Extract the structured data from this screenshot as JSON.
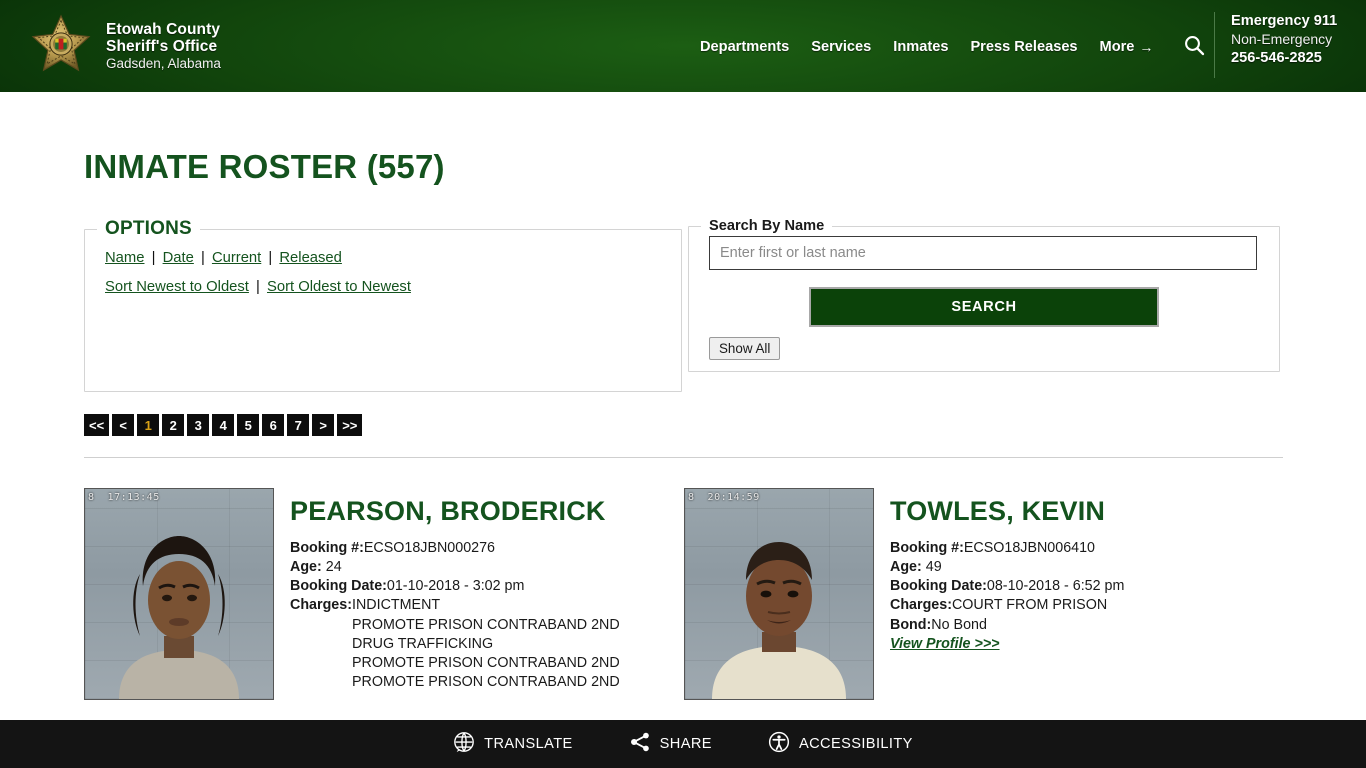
{
  "header": {
    "brand": {
      "line1": "Etowah County",
      "line2": "Sheriff's Office",
      "line3": "Gadsden, Alabama",
      "badge_icon": "sheriff-star-badge-icon"
    },
    "nav": [
      {
        "label": "Departments"
      },
      {
        "label": "Services"
      },
      {
        "label": "Inmates"
      },
      {
        "label": "Press Releases"
      },
      {
        "label": "More",
        "arrow": "→"
      }
    ],
    "search_icon": "search-icon",
    "contact": {
      "emergency": "Emergency 911",
      "non_emergency_label": "Non-Emergency",
      "non_emergency_number": "256-546-2825"
    },
    "colors": {
      "bg_dark": "#062a06",
      "bg_mid": "#134a0f",
      "text": "#ffffff"
    }
  },
  "page": {
    "title": "INMATE ROSTER (557)",
    "title_color": "#14531e"
  },
  "options": {
    "legend": "OPTIONS",
    "row1": [
      {
        "label": "Name"
      },
      {
        "label": "Date"
      },
      {
        "label": "Current"
      },
      {
        "label": "Released"
      }
    ],
    "row2": [
      {
        "label": "Sort Newest to Oldest"
      },
      {
        "label": "Sort Oldest to Newest"
      }
    ],
    "separator": "|"
  },
  "search": {
    "legend": "Search By Name",
    "placeholder": "Enter first or last name",
    "value": "",
    "submit_label": "SEARCH",
    "show_all_label": "Show All",
    "submit_color": "#0b4209"
  },
  "pagination": {
    "items": [
      "<<",
      "<",
      "1",
      "2",
      "3",
      "4",
      "5",
      "6",
      "7",
      ">",
      ">>"
    ],
    "active": "1",
    "active_color": "#d9a217",
    "bg_color": "#0d0d0d"
  },
  "roster": [
    {
      "name": "PEARSON, BRODERICK",
      "mug_stamp": "8  17:13:45",
      "booking_label": "Booking #:",
      "booking_value": "ECSO18JBN000276",
      "age_label": "Age:",
      "age_value": "24",
      "booking_date_label": "Booking Date:",
      "booking_date_value": "01-10-2018 - 3:02 pm",
      "charges_label": "Charges:",
      "charges_first": "INDICTMENT",
      "charges_rest": [
        "PROMOTE PRISON CONTRABAND 2ND",
        "DRUG TRAFFICKING",
        "PROMOTE PRISON CONTRABAND 2ND",
        "PROMOTE PRISON CONTRABAND 2ND"
      ],
      "bond_label": "",
      "bond_value": "",
      "profile_link": ""
    },
    {
      "name": "TOWLES, KEVIN",
      "mug_stamp": "8  20:14:59",
      "booking_label": "Booking #:",
      "booking_value": "ECSO18JBN006410",
      "age_label": "Age:",
      "age_value": "49",
      "booking_date_label": "Booking Date:",
      "booking_date_value": "08-10-2018 - 6:52 pm",
      "charges_label": "Charges:",
      "charges_first": "COURT FROM PRISON",
      "charges_rest": [],
      "bond_label": "Bond:",
      "bond_value": "No Bond",
      "profile_link": "View Profile >>>"
    }
  ],
  "footer": {
    "items": [
      {
        "label": "TRANSLATE",
        "icon": "globe-speech-icon"
      },
      {
        "label": "SHARE",
        "icon": "share-nodes-icon"
      },
      {
        "label": "ACCESSIBILITY",
        "icon": "accessibility-person-icon"
      }
    ],
    "bg_color": "#141414"
  }
}
